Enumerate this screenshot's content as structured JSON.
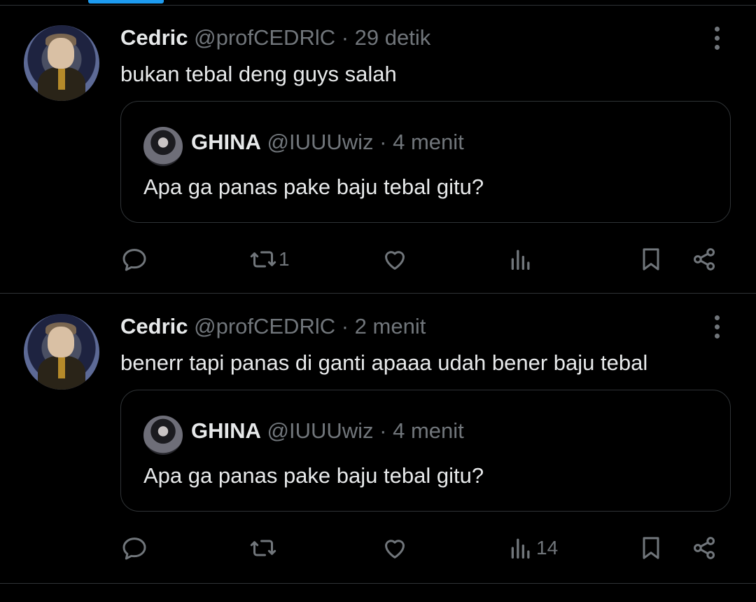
{
  "colors": {
    "background": "#000000",
    "text": "#e7e9ea",
    "muted": "#71767b",
    "border": "#2f3336",
    "accent": "#1d9bf0"
  },
  "tweets": [
    {
      "name": "Cedric",
      "handle": "@profCEDRlC",
      "time": "· 29 detik",
      "text": "bukan tebal deng guys salah",
      "quote": {
        "name": "GHINA",
        "handle": "@IUUUwiz",
        "time": "· 4 menit",
        "text": "Apa ga panas pake baju tebal gitu?"
      },
      "stats": {
        "replies": "",
        "retweets": "1",
        "likes": "",
        "views": ""
      }
    },
    {
      "name": "Cedric",
      "handle": "@profCEDRlC",
      "time": "· 2 menit",
      "text": "benerr tapi panas di ganti apaaa udah bener baju tebal",
      "quote": {
        "name": "GHINA",
        "handle": "@IUUUwiz",
        "time": "· 4 menit",
        "text": "Apa ga panas pake baju tebal gitu?"
      },
      "stats": {
        "replies": "",
        "retweets": "",
        "likes": "",
        "views": "14"
      }
    }
  ],
  "icons": [
    "more-icon",
    "reply-icon",
    "retweet-icon",
    "like-icon",
    "views-icon",
    "bookmark-icon",
    "share-icon"
  ]
}
